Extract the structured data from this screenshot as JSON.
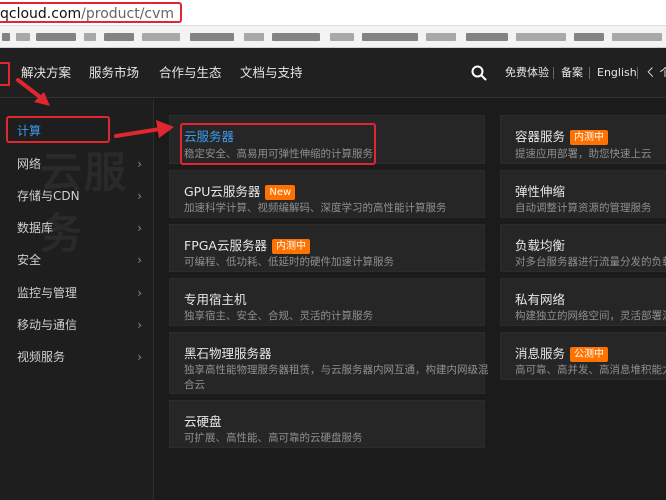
{
  "address_bar": {
    "host": "qcloud.com",
    "path": "/product/cvm"
  },
  "nav": {
    "items": [
      "解决方案",
      "服务市场",
      "合作与生态",
      "文档与支持"
    ],
    "right": [
      "免费体验",
      "备案",
      "English",
      "ㄑ 个"
    ]
  },
  "sidebar": {
    "ghost_text": "云服务",
    "items": [
      {
        "label": "计算"
      },
      {
        "label": "网络"
      },
      {
        "label": "存储与CDN"
      },
      {
        "label": "数据库"
      },
      {
        "label": "安全"
      },
      {
        "label": "监控与管理"
      },
      {
        "label": "移动与通信"
      },
      {
        "label": "视频服务"
      }
    ]
  },
  "products_left": [
    {
      "title": "云服务器",
      "badge": "",
      "desc": "稳定安全、高易用可弹性伸缩的计算服务",
      "desc2": ""
    },
    {
      "title": "GPU云服务器",
      "badge": "New",
      "desc": "加速科学计算、视频编解码、深度学习的高性能计算服务",
      "desc2": ""
    },
    {
      "title": "FPGA云服务器",
      "badge": "内测中",
      "desc": "可编程、低功耗、低延时的硬件加速计算服务",
      "desc2": ""
    },
    {
      "title": "专用宿主机",
      "badge": "",
      "desc": "独享宿主、安全、合规、灵活的计算服务",
      "desc2": ""
    },
    {
      "title": "黑石物理服务器",
      "badge": "",
      "desc": "独享高性能物理服务器租赁，与云服务器内网互通，构建内网级混",
      "desc2": "合云"
    },
    {
      "title": "云硬盘",
      "badge": "",
      "desc": "可扩展、高性能、高可靠的云硬盘服务",
      "desc2": ""
    }
  ],
  "products_right": [
    {
      "title": "容器服务",
      "badge": "内测中",
      "desc": "提速应用部署，助您快速上云"
    },
    {
      "title": "弹性伸缩",
      "badge": "",
      "desc": "自动调整计算资源的管理服务"
    },
    {
      "title": "负载均衡",
      "badge": "",
      "desc": "对多台服务器进行流量分发的负载均"
    },
    {
      "title": "私有网络",
      "badge": "",
      "desc": "构建独立的网络空间，灵活部署混合"
    },
    {
      "title": "消息服务",
      "badge": "公测中",
      "desc": "高可靠、高并发、高消息堆积能力的"
    }
  ],
  "colors": {
    "accent": "#3b9cf0",
    "badge": "#ff7200",
    "annotation": "#e0262f"
  }
}
